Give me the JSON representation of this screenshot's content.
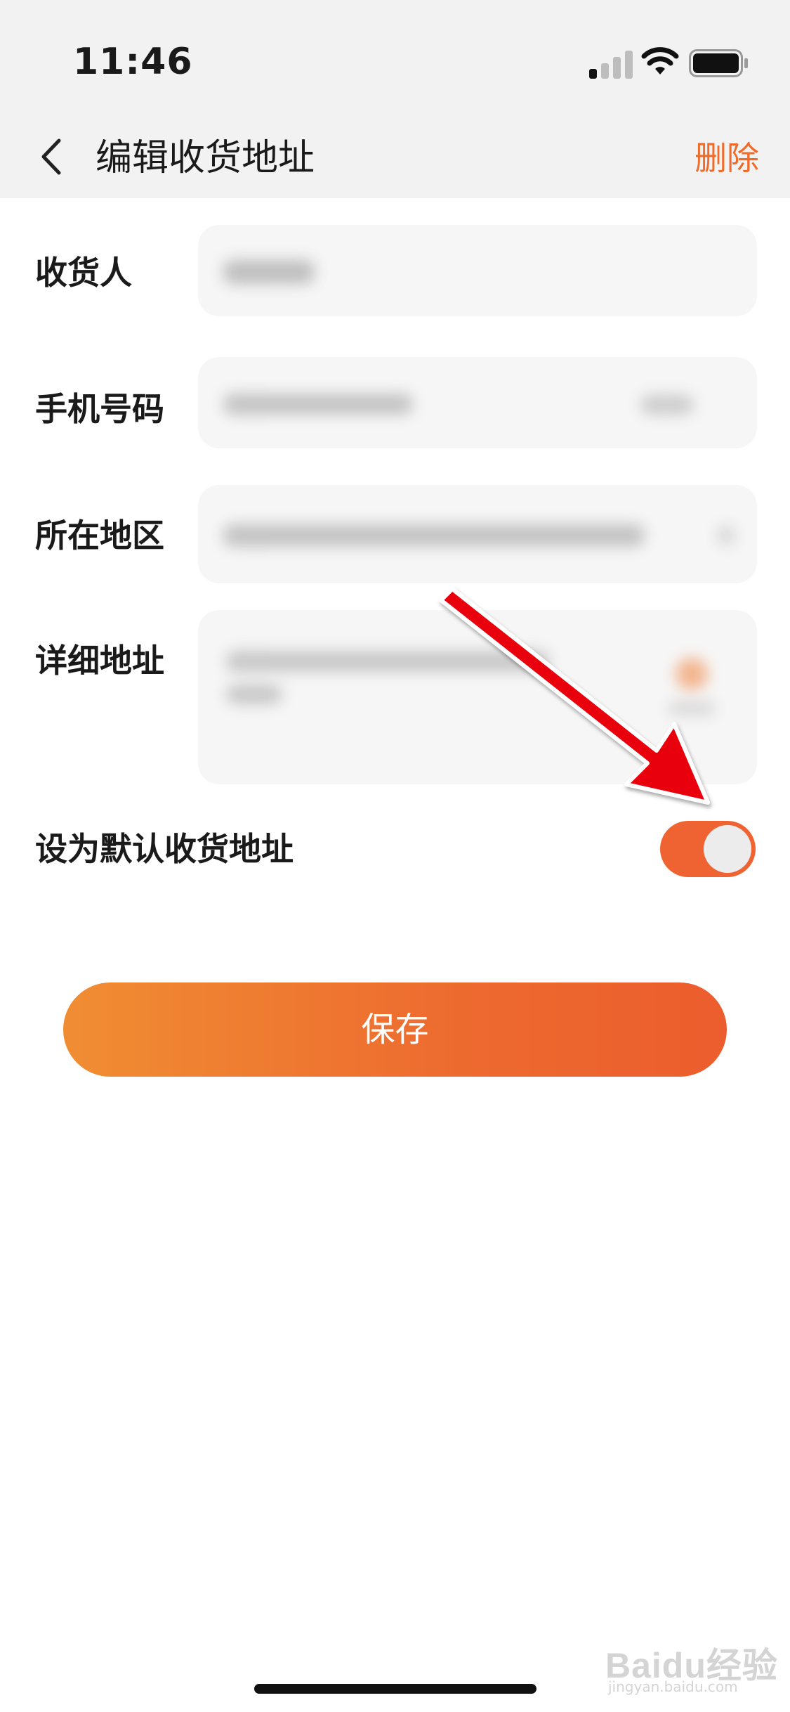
{
  "status_bar": {
    "time": "11:46",
    "icons": [
      "signal-icon",
      "wifi-icon",
      "battery-icon"
    ]
  },
  "navbar": {
    "back_icon": "chevron-left-icon",
    "title": "编辑收货地址",
    "action": "删除",
    "action_color": "#f06a2a"
  },
  "form": {
    "recipient": {
      "label": "收货人"
    },
    "phone": {
      "label": "手机号码"
    },
    "region": {
      "label": "所在地区"
    },
    "detail_address": {
      "label": "详细地址"
    }
  },
  "default_address": {
    "label": "设为默认收货地址",
    "enabled": true,
    "toggle_color": "#ee6331"
  },
  "save_button": {
    "label": "保存",
    "gradient": [
      "#f08d33",
      "#ec5d2d"
    ]
  },
  "watermark": {
    "brand": "Baidu经验",
    "url": "jingyan.baidu.com"
  }
}
